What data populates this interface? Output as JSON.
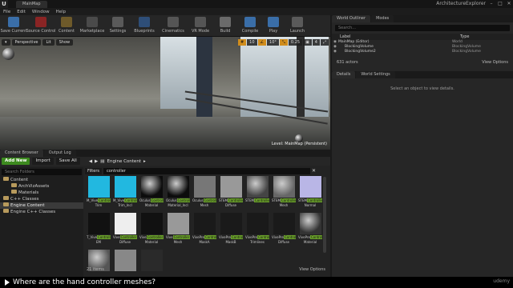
{
  "titlebar": {
    "tab": "MainMap",
    "app": "ArchitectureExplorer",
    "logo": "U"
  },
  "menu": [
    "File",
    "Edit",
    "Window",
    "Help"
  ],
  "toolbar": [
    {
      "label": "Save Current",
      "color": "#3a6ea8"
    },
    {
      "label": "Source Control",
      "color": "#8a2424"
    },
    {
      "label": "Content",
      "color": "#6e5a2a"
    },
    {
      "label": "Marketplace",
      "color": "#4a4a4a"
    },
    {
      "label": "Settings",
      "color": "#5a5a5a"
    },
    {
      "label": "Blueprints",
      "color": "#2e4e78"
    },
    {
      "label": "Cinematics",
      "color": "#555"
    },
    {
      "label": "VR Mode",
      "color": "#555"
    },
    {
      "label": "Build",
      "color": "#6a6a6a"
    },
    {
      "label": "Compile",
      "color": "#3a6ea8"
    },
    {
      "label": "Play",
      "color": "#3a6ea8"
    },
    {
      "label": "Launch",
      "color": "#5a5a5a"
    }
  ],
  "viewport": {
    "perspective": "Perspective",
    "lit": "Lit",
    "show": "Show",
    "nums": [
      "10",
      "10°",
      "0.25",
      "4"
    ],
    "level": "Level: MainMap (Persistent)"
  },
  "outliner": {
    "tabs": [
      "World Outliner",
      "Modes"
    ],
    "search_placeholder": "Search...",
    "col_label": "Label",
    "col_type": "Type",
    "rows": [
      {
        "label": "MainMap (Editor)",
        "type": "World"
      },
      {
        "label": "BlockingVolume",
        "type": "BlockingVolume"
      },
      {
        "label": "BlockingVolume2",
        "type": "BlockingVolume"
      }
    ],
    "count": "631 actors",
    "view_options": "View Options"
  },
  "details": {
    "tabs": [
      "Details",
      "World Settings"
    ],
    "message": "Select an object to view details."
  },
  "content_browser": {
    "tabs": [
      "Content Browser",
      "Output Log"
    ],
    "add_new": "Add New",
    "import": "Import",
    "save_all": "Save All",
    "breadcrumb": "Engine Content",
    "search_folders": "Search Folders",
    "filters": "Filters",
    "filter_text": "controller",
    "tree": [
      {
        "label": "Content",
        "indent": 0
      },
      {
        "label": "ArchVizAssets",
        "indent": 1
      },
      {
        "label": "Materials",
        "indent": 1
      },
      {
        "label": "C++ Classes",
        "indent": 0
      },
      {
        "label": "Engine Content",
        "indent": 0,
        "selected": true
      },
      {
        "label": "Engine C++ Classes",
        "indent": 0
      }
    ],
    "items_count": "21 items",
    "view_options": "View Options",
    "assets": [
      {
        "pre": "M_Vive",
        "hl": "Controller",
        "post": "Trim",
        "thumb": "#22b8e0"
      },
      {
        "pre": "M_Vive",
        "hl": "Controller",
        "post": "Trim_Incl",
        "thumb": "#22b8e0"
      },
      {
        "pre": "Oculus",
        "hl": "Controller",
        "post": "Material",
        "thumb": "#0c0c0c"
      },
      {
        "pre": "Oculus",
        "hl": "Controller",
        "post": "Material_Incl",
        "thumb": "#0c0c0c"
      },
      {
        "pre": "Oculus",
        "hl": "Controller",
        "post": "Mesh",
        "thumb": "#777"
      },
      {
        "pre": "STEM",
        "hl": "Controller",
        "post": "Diffuse",
        "thumb": "#999"
      },
      {
        "pre": "STEM",
        "hl": "ControllerMat",
        "post": "",
        "thumb": "#444"
      },
      {
        "pre": "STEM",
        "hl": "Controller",
        "post": "Mesh",
        "thumb": "#666"
      },
      {
        "pre": "STEM",
        "hl": "Controller",
        "post": "Normal",
        "thumb": "#b9b6e6"
      },
      {
        "pre": "T_Vive",
        "hl": "Controller",
        "post": "EM",
        "thumb": "#111"
      },
      {
        "pre": "Vive",
        "hl": "Controller",
        "post": "Diffuse",
        "thumb": "#eee"
      },
      {
        "pre": "Vive",
        "hl": "Controller",
        "post": "Material",
        "thumb": "#111"
      },
      {
        "pre": "Vive",
        "hl": "Controller",
        "post": "Mesh",
        "thumb": "#999"
      },
      {
        "pre": "VivePre",
        "hl": "Controller",
        "post": "MaskA",
        "thumb": "#1a1a1a"
      },
      {
        "pre": "VivePre",
        "hl": "Controller",
        "post": "MaskB",
        "thumb": "#1a1a1a"
      },
      {
        "pre": "VivePre",
        "hl": "Controller",
        "post": "Trimlines",
        "thumb": "#1a1a1a"
      },
      {
        "pre": "VivePre",
        "hl": "Controller",
        "post": "Diffuse",
        "thumb": "#1a1a1a"
      },
      {
        "pre": "VivePre",
        "hl": "Controller",
        "post": "Material",
        "thumb": "#333"
      },
      {
        "pre": "",
        "hl": "",
        "post": "",
        "thumb": "#555"
      },
      {
        "pre": "",
        "hl": "",
        "post": "",
        "thumb": "#888"
      },
      {
        "pre": "",
        "hl": "",
        "post": "",
        "thumb": "#2a2a2a"
      }
    ]
  },
  "caption": {
    "text": "Where are the hand controller meshes?",
    "brand": "udemy"
  }
}
